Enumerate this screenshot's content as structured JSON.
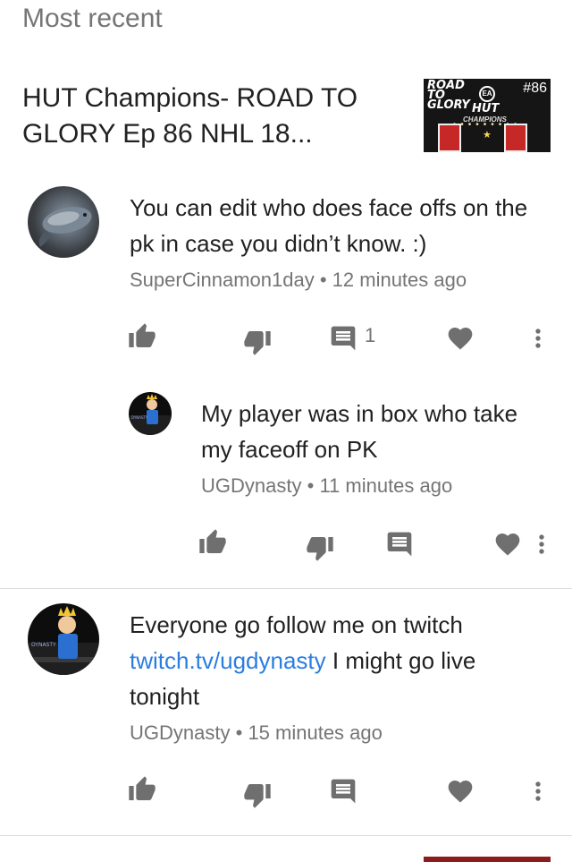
{
  "section": {
    "title": "Most recent"
  },
  "video": {
    "title": "HUT Champions- ROAD TO GLORY Ep 86  NHL 18...",
    "thumbnail": {
      "road_line1": "ROAD",
      "road_line2": "TO",
      "road_line3": "GLORY",
      "number": "#86",
      "logo": "EA",
      "hut": "HUT",
      "champions": "CHAMPIONS"
    }
  },
  "comments": [
    {
      "author": "SuperCinnamon1day",
      "time": "12 minutes ago",
      "text": "You can edit who does face offs on the pk in case you didn’t know. :)",
      "reply_count": "1",
      "replies": [
        {
          "author": "UGDynasty",
          "time": "11 minutes ago",
          "text": "My player was in box who take my faceoff on PK"
        }
      ]
    },
    {
      "author": "UGDynasty",
      "time": "15 minutes ago",
      "text_before": "Everyone go follow me on twitch",
      "link": "twitch.tv/ugdynasty",
      "text_after": " I might go live tonight"
    }
  ],
  "meta_separator": "•",
  "icons": {
    "like": "thumbs-up-icon",
    "dislike": "thumbs-down-icon",
    "reply": "comment-icon",
    "heart": "heart-icon",
    "more": "more-vert-icon"
  },
  "colors": {
    "link": "#2a7de1",
    "icon": "#6f6f6f",
    "meta": "#757575"
  }
}
